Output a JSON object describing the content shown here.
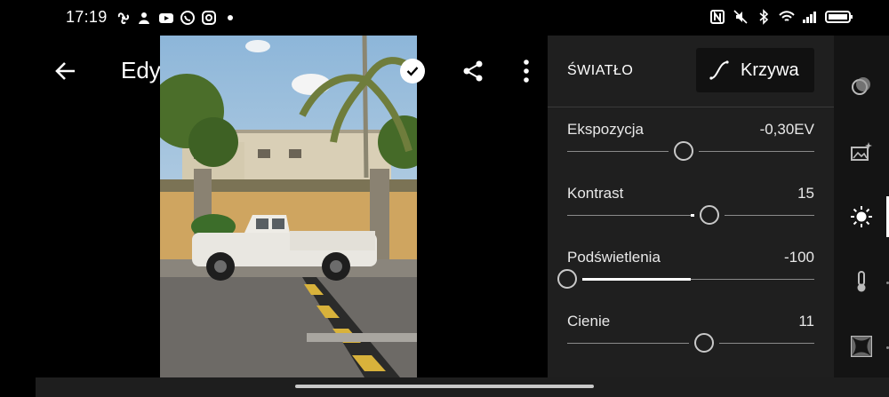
{
  "status": {
    "time": "17:19",
    "left_icons": [
      "fan-icon",
      "person-icon",
      "youtube-icon",
      "whatsapp-icon",
      "instagram-icon",
      "dot-icon"
    ],
    "right_icons": [
      "nfc-icon",
      "mute-icon",
      "bluetooth-icon",
      "wifi-icon",
      "signal-icon",
      "battery-icon"
    ]
  },
  "topbar": {
    "title": "Edytuj",
    "back_icon": "arrow-left-icon",
    "confirm_icon": "checkmark-circle-icon",
    "share_icon": "share-icon",
    "more_icon": "more-vertical-icon"
  },
  "panel": {
    "title": "ŚWIATŁO",
    "curve_button_label": "Krzywa",
    "sliders": [
      {
        "label": "Ekspozycja",
        "value": "-0,30EV",
        "position": 0.47,
        "fill_from": null
      },
      {
        "label": "Kontrast",
        "value": "15",
        "position": 0.575,
        "fill_from": 0.5
      },
      {
        "label": "Podświetlenia",
        "value": "-100",
        "position": 0.0,
        "fill_from": 0.5
      },
      {
        "label": "Cienie",
        "value": "11",
        "position": 0.555,
        "fill_from": 0.5
      }
    ]
  },
  "sidebar": {
    "items": [
      {
        "icon": "presets-icon",
        "active": false
      },
      {
        "icon": "auto-enhance-icon",
        "active": false
      },
      {
        "icon": "light-sun-icon",
        "active": true
      },
      {
        "icon": "color-temperature-icon",
        "active": false
      },
      {
        "icon": "effects-vignette-icon",
        "active": false
      }
    ]
  },
  "colors": {
    "panel_bg": "#1f1f1f",
    "sidebar_bg": "#141414",
    "accent": "#ffffff"
  }
}
